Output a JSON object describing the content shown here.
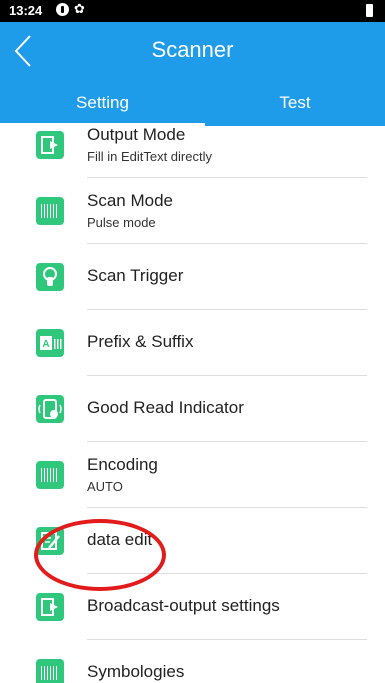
{
  "status_bar": {
    "time": "13:24",
    "settings_glyph": "✿"
  },
  "app_bar": {
    "title": "Scanner"
  },
  "tabs": [
    {
      "label": "Setting"
    },
    {
      "label": "Test"
    }
  ],
  "items": [
    {
      "title": "Output Mode",
      "subtitle": "Fill in EditText directly",
      "icon": "output-icon"
    },
    {
      "title": "Scan Mode",
      "subtitle": "Pulse mode",
      "icon": "barcode-icon"
    },
    {
      "title": "Scan Trigger",
      "subtitle": "",
      "icon": "trigger-icon"
    },
    {
      "title": "Prefix & Suffix",
      "subtitle": "",
      "icon": "prefix-suffix-icon"
    },
    {
      "title": "Good Read Indicator",
      "subtitle": "",
      "icon": "good-read-icon"
    },
    {
      "title": "Encoding",
      "subtitle": "AUTO",
      "icon": "encoding-icon"
    },
    {
      "title": "data edit",
      "subtitle": "",
      "icon": "data-edit-icon"
    },
    {
      "title": "Broadcast-output settings",
      "subtitle": "",
      "icon": "broadcast-icon"
    },
    {
      "title": "Symbologies",
      "subtitle": "",
      "icon": "symbology-icon"
    }
  ],
  "colors": {
    "primary": "#1e9be9",
    "icon_green": "#2ec77c",
    "annotation_red": "#e21b1b"
  }
}
